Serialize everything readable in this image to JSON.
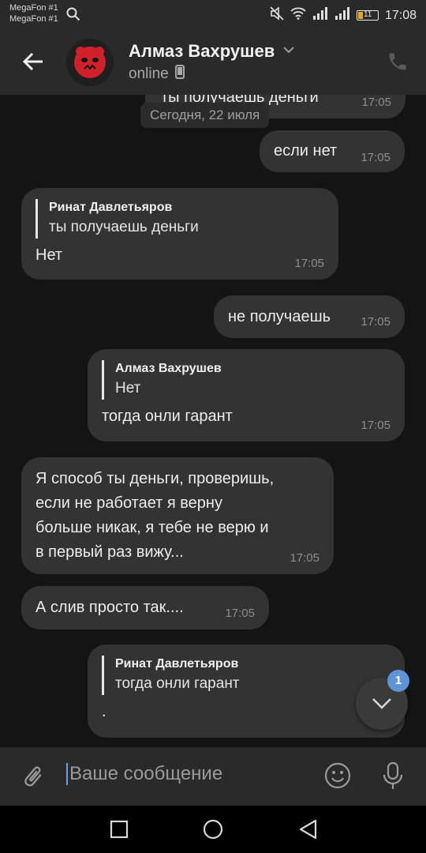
{
  "status_bar": {
    "carrier_1": "MegaFon #1",
    "carrier_2": "MegaFon #1",
    "time": "17:08",
    "battery": "11"
  },
  "header": {
    "name": "Алмаз Вахрушев",
    "status": "online"
  },
  "chat": {
    "partial_top_text": "ты получаешь деньги",
    "partial_top_time": "17:05",
    "date_separator": "Сегодня, 22 июля",
    "messages": [
      {
        "text": "если нет",
        "time": "17:05"
      },
      {
        "quote_author": "Ринат Давлетьяров",
        "quote_text": "ты получаешь деньги",
        "text": "Нет",
        "time": "17:05"
      },
      {
        "text": "не получаешь",
        "time": "17:05"
      },
      {
        "quote_author": "Алмаз Вахрушев",
        "quote_text": "Нет",
        "text": "тогда онли гарант",
        "time": "17:05"
      },
      {
        "lines": [
          "Я способ ты деньги, проверишь,",
          "если не работает я верну",
          "больше никак, я тебе не верю и",
          "в первый раз вижу..."
        ],
        "time": "17:05"
      },
      {
        "text": "А слив просто так....",
        "time": "17:05"
      },
      {
        "quote_author": "Ринат Давлетьяров",
        "quote_text": "тогда онли гарант",
        "text": "."
      }
    ],
    "scroll_badge": "1"
  },
  "composer": {
    "placeholder": "Ваше сообщение"
  },
  "colors": {
    "bubble": "#333334",
    "background": "#141414",
    "accent": "#5e93d6"
  },
  "icons": [
    "search-icon",
    "mute-icon",
    "wifi-icon",
    "signal-icon",
    "battery-icon",
    "back-arrow-icon",
    "phone-icon",
    "mobile-device-icon",
    "chevron-down-icon",
    "attach-icon",
    "emoji-icon",
    "mic-icon",
    "square-nav-icon",
    "circle-nav-icon",
    "triangle-nav-icon"
  ]
}
